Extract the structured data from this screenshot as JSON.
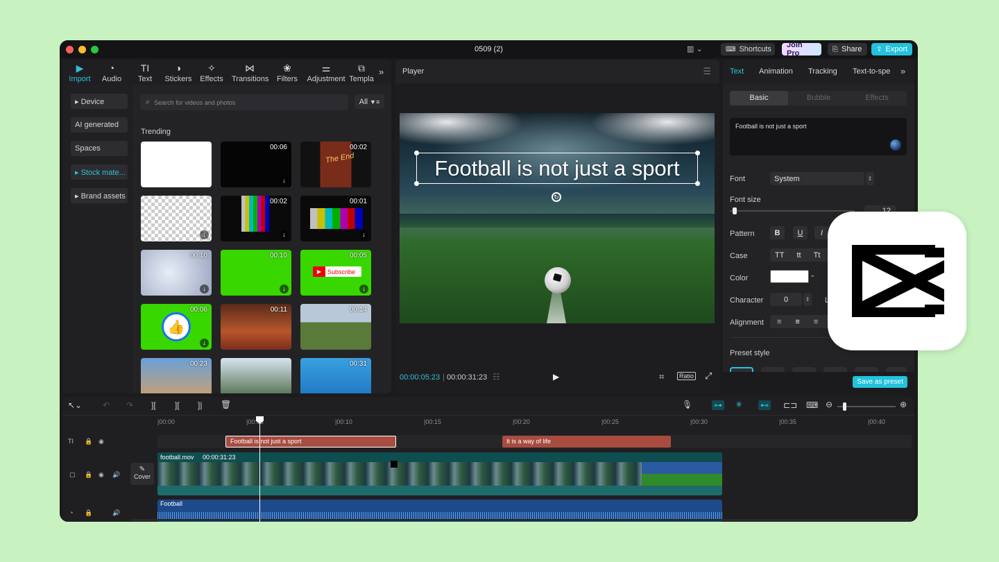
{
  "window": {
    "title": "0509 (2)"
  },
  "titlebar": {
    "shortcuts": "Shortcuts",
    "join_pro": "Join Pro",
    "share": "Share",
    "export": "Export"
  },
  "toolbar": {
    "tabs": [
      {
        "label": "Import",
        "icon": "import-icon"
      },
      {
        "label": "Audio",
        "icon": "audio-icon"
      },
      {
        "label": "Text",
        "icon": "text-icon"
      },
      {
        "label": "Stickers",
        "icon": "stickers-icon"
      },
      {
        "label": "Effects",
        "icon": "effects-icon"
      },
      {
        "label": "Transitions",
        "icon": "transitions-icon"
      },
      {
        "label": "Filters",
        "icon": "filters-icon"
      },
      {
        "label": "Adjustment",
        "icon": "adjustment-icon"
      },
      {
        "label": "Templa",
        "icon": "templates-icon"
      }
    ]
  },
  "sidebar": {
    "items": [
      {
        "label": "▸ Device"
      },
      {
        "label": "AI generated"
      },
      {
        "label": "Spaces"
      },
      {
        "label": "▸ Stock mate..."
      },
      {
        "label": "▸ Brand assets"
      }
    ]
  },
  "media": {
    "search_placeholder": "Search for videos and photos",
    "filter_label": "All",
    "section_title": "Trending",
    "durations": [
      "",
      "00:06",
      "00:02",
      "",
      "00:02",
      "00:01",
      "00:10",
      "00:10",
      "00:05",
      "00:06",
      "00:11",
      "00:14",
      "00:23",
      "",
      "00:31"
    ],
    "subscribe_label": "Subscribe"
  },
  "player": {
    "title": "Player",
    "overlay_text": "Football is not just a sport",
    "current_time": "00:00:05:23",
    "total_time": "00:00:31:23",
    "ratio_label": "Ratio"
  },
  "inspector": {
    "tabs": [
      "Text",
      "Animation",
      "Tracking",
      "Text-to-spe"
    ],
    "subtabs": [
      "Basic",
      "Bubble",
      "Effects"
    ],
    "text_value": "Football is not just a sport",
    "font_label": "Font",
    "font_value": "System",
    "font_size_label": "Font size",
    "font_size_value": "12",
    "pattern_label": "Pattern",
    "pattern_buttons": [
      "B",
      "U",
      "I"
    ],
    "case_label": "Case",
    "case_buttons": [
      "TT",
      "tt",
      "Tt"
    ],
    "color_label": "Color",
    "character_label": "Character",
    "character_value": "0",
    "line_label": "L",
    "alignment_label": "Alignment",
    "preset_label": "Preset style",
    "save_preset": "Save as preset"
  },
  "timeline": {
    "ruler": [
      "|00:00",
      "|00:05",
      "|00:10",
      "|00:15",
      "|00:20",
      "|00:25",
      "|00:30",
      "|00:35",
      "|00:40"
    ],
    "text_clips": [
      "Football is not just a sport",
      "It is a way of life"
    ],
    "video_clip_name": "football.mov",
    "video_clip_duration": "00:00:31:23",
    "audio_clip_name": "Football",
    "cover_label": "Cover"
  }
}
